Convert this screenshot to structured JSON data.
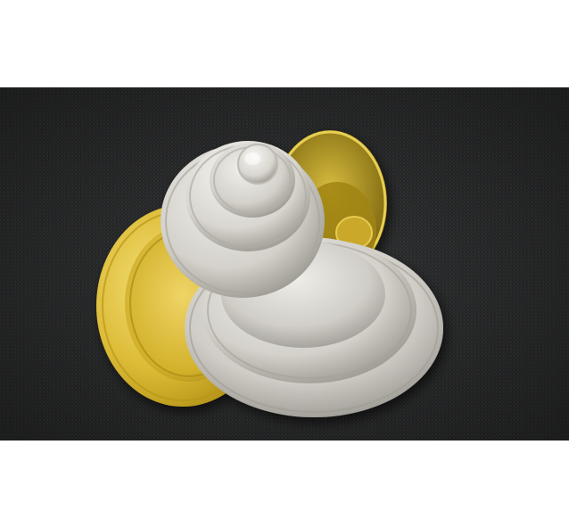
{
  "image": {
    "subject": "stacked-metal-trays",
    "palette": {
      "background_page": "#ffffff",
      "fabric_dark": "#2b2c2d",
      "fabric_light": "#3a3b3c",
      "brass_light": "#f2dc6a",
      "brass_mid": "#d9b62e",
      "brass_dark": "#9a7b10",
      "silver_light": "#ecebe6",
      "silver_mid": "#c9c7c0",
      "silver_dark": "#8f8d86"
    }
  }
}
